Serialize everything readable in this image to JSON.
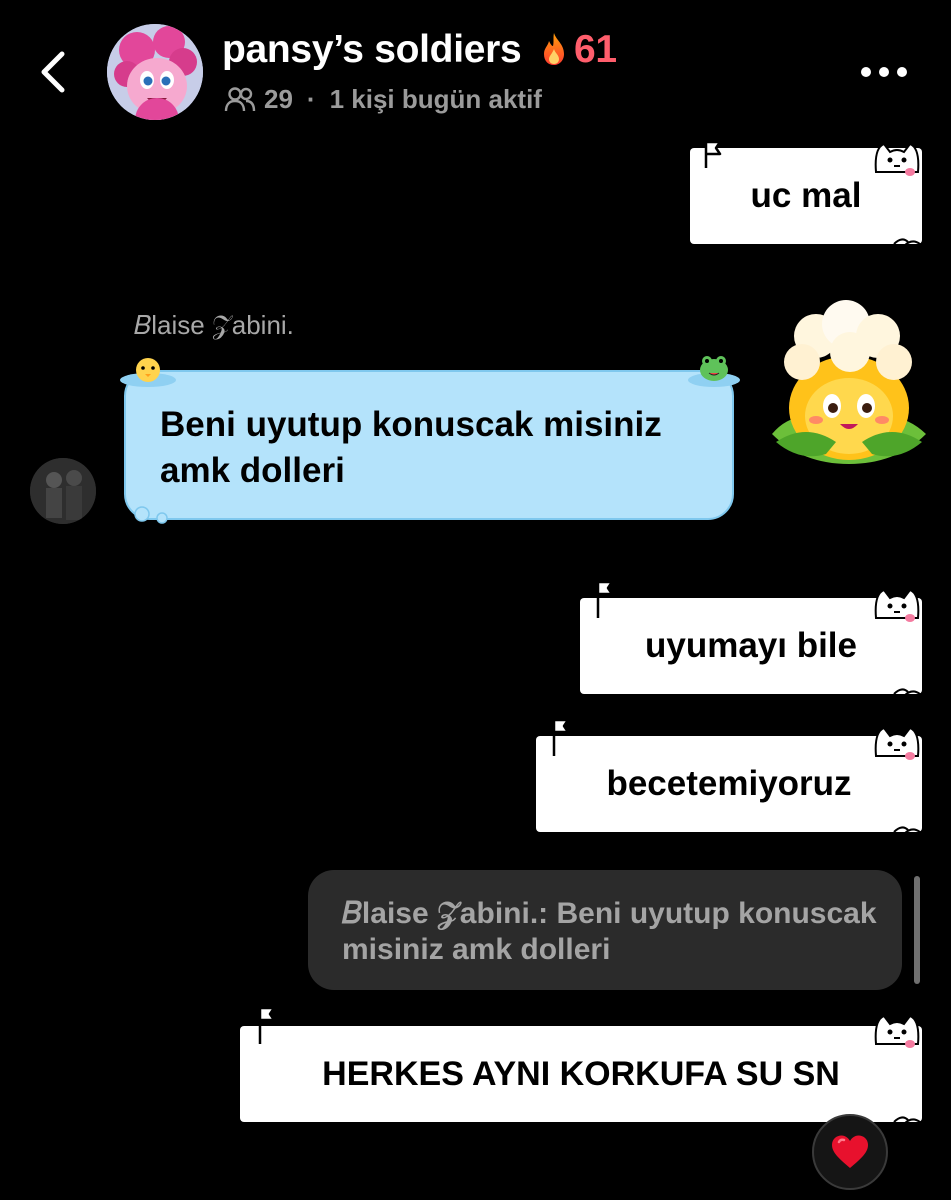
{
  "header": {
    "group_name": "pansy’s soldiers",
    "streak": "61",
    "member_count": "29",
    "separator": "·",
    "active_text": "1 kişi bugün aktif"
  },
  "messages": {
    "m1": "uc mal",
    "sender": "𝐵laise 𝒵abini.",
    "m2": "Beni uyutup konuscak misiniz amk dolleri",
    "m3": "uyumayı bile",
    "m4": "becetemiyoruz",
    "reply_preview": "𝐵laise 𝒵abini.: Beni uyutup konuscak misiniz amk dolleri",
    "m5": "HERKES AYNI KORKUFA SU SN"
  },
  "icons": {
    "back": "chevron-left-icon",
    "more": "more-horizontal-icon",
    "members": "people-icon",
    "fire": "fire-icon",
    "heart": "heart-icon"
  },
  "colors": {
    "background": "#000000",
    "streak": "#ff5e6c",
    "blue_bubble": "#b4e3fb",
    "reply_bg": "#2b2b2b",
    "heart": "#e8112d"
  }
}
